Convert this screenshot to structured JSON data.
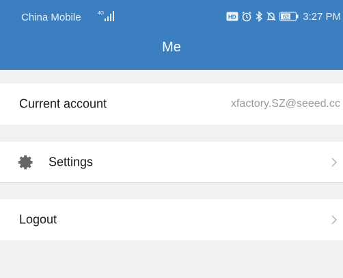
{
  "status_bar": {
    "carrier": "China Mobile",
    "network_badge": "4G",
    "battery_level": "63",
    "time": "3:27 PM",
    "icons": [
      "signal-icon",
      "hd-icon",
      "alarm-icon",
      "bluetooth-icon",
      "mute-icon",
      "battery-icon"
    ]
  },
  "header": {
    "title": "Me",
    "color": "#3b7fc1"
  },
  "rows": {
    "current_account": {
      "label": "Current account",
      "value": "xfactory.SZ@seeed.cc"
    },
    "settings": {
      "label": "Settings",
      "icon": "gear-icon"
    },
    "logout": {
      "label": "Logout"
    }
  }
}
